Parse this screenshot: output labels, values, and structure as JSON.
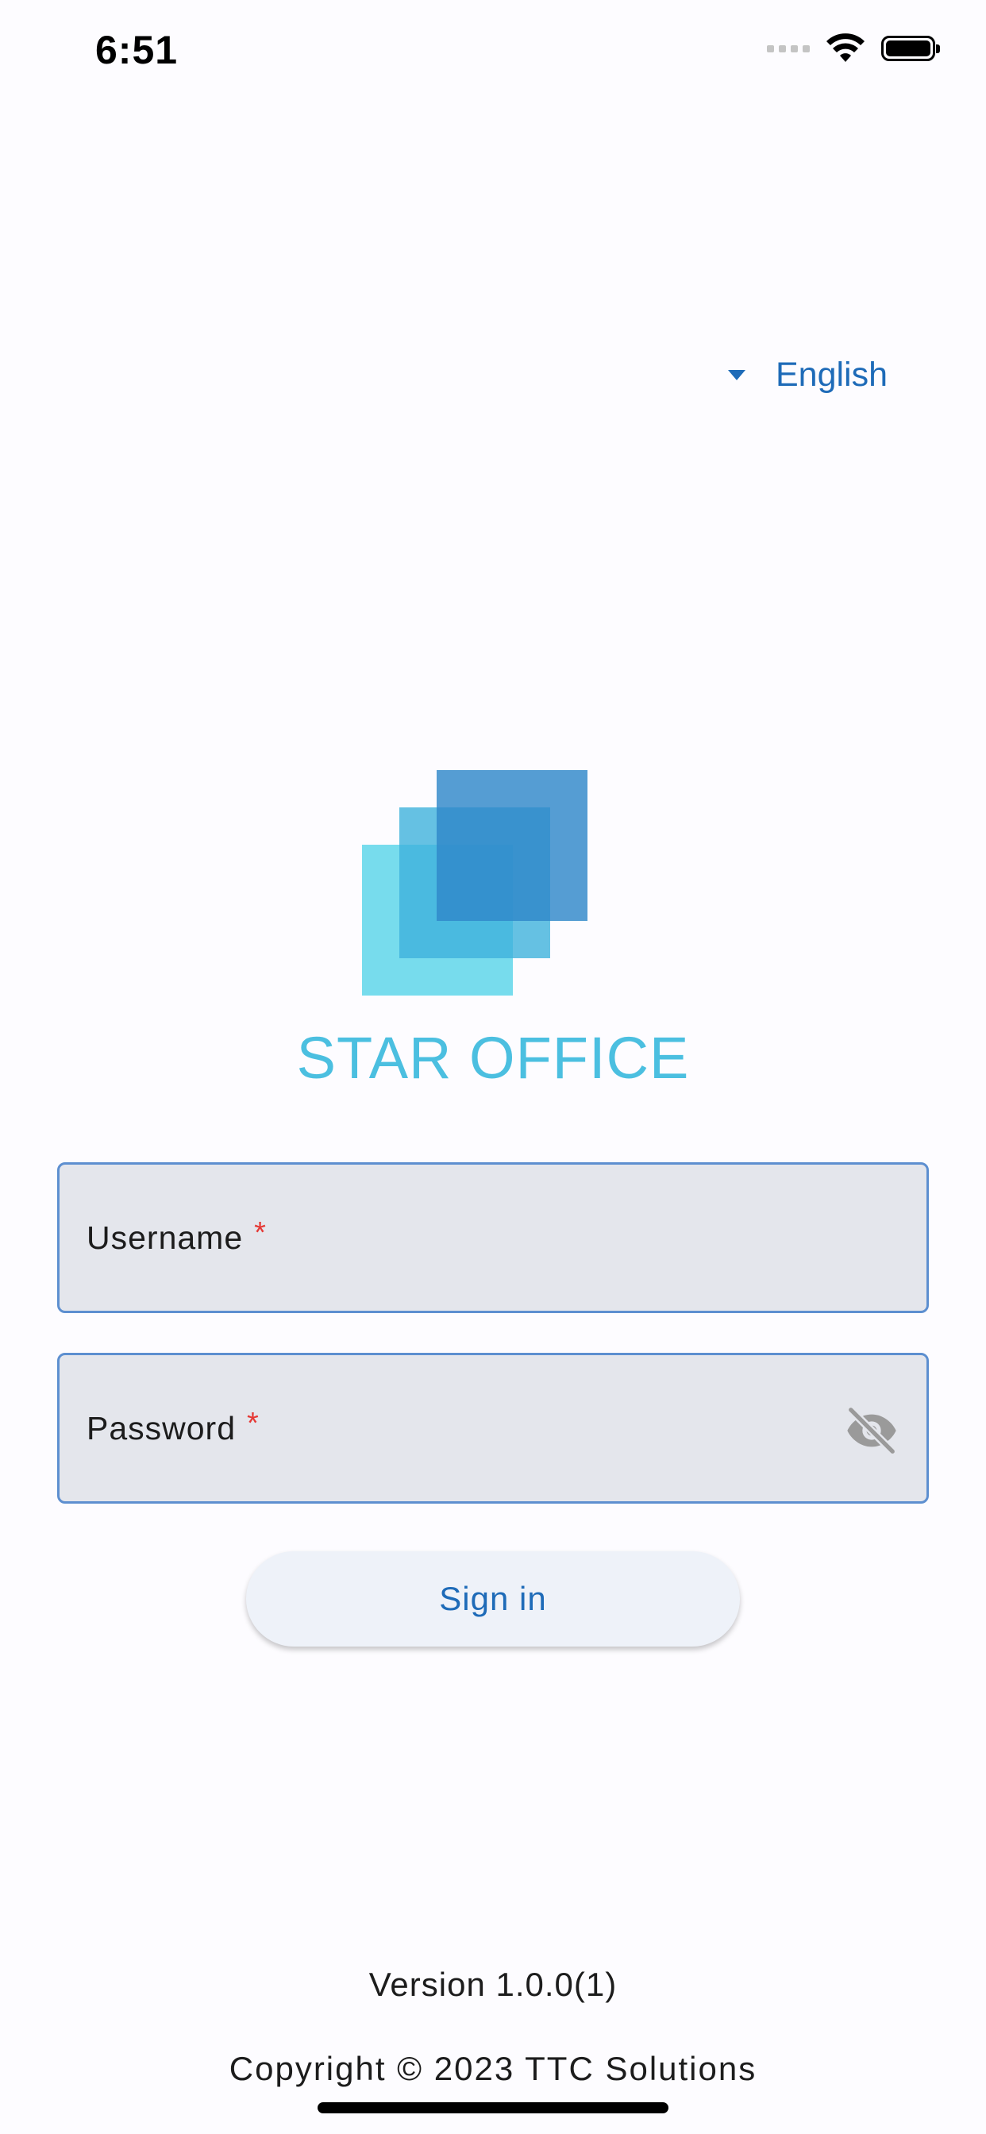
{
  "status_bar": {
    "time": "6:51"
  },
  "language": {
    "label": "English",
    "icon": "caret-down-icon",
    "color": "#1e6bb8"
  },
  "brand": {
    "name": "STAR OFFICE",
    "logo_colors": [
      "#6ddcee",
      "#4aafdc",
      "#2e84c8"
    ]
  },
  "form": {
    "username": {
      "label": "Username",
      "required_mark": "*",
      "value": ""
    },
    "password": {
      "label": "Password",
      "required_mark": "*",
      "value": "",
      "toggle_icon": "eye-off-icon"
    },
    "submit_label": "Sign in"
  },
  "footer": {
    "version": "Version 1.0.0(1)",
    "copyright": "Copyright © 2023 TTC Solutions"
  }
}
